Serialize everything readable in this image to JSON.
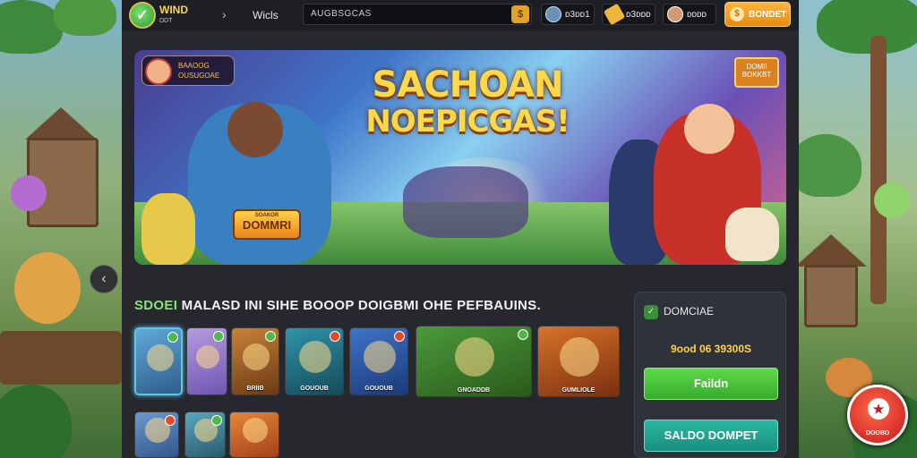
{
  "header": {
    "brand_name": "WIND",
    "brand_sub": "DDT",
    "nav_chevron": "›",
    "nav_link": "Wicls",
    "search_value": "AUGBSGCAS",
    "stats": [
      {
        "name": "stat-balance",
        "value": "ᴅ3ᴅᴅ1",
        "icon": "avatar-icon"
      },
      {
        "name": "stat-coins",
        "value": "ᴅ3ᴅᴅᴅ",
        "icon": "coin-icon"
      },
      {
        "name": "stat-profile",
        "value": "ᴅᴅᴅᴅ",
        "icon": "avatar-icon"
      }
    ],
    "deposit_label": "BONDET"
  },
  "banner": {
    "title_line1": "SACHOAN",
    "title_line2": "NOEPICGAS!",
    "player_line1": "BAAOOG",
    "player_line2": "OUSUGOAE",
    "promo_line1": "DOMII",
    "promo_line2": "BOKKBT",
    "game_logo_top": "SOAKOR",
    "game_logo_main": "DOMMRI"
  },
  "games_section": {
    "title_accent": "SDOEI",
    "title_rest": "MALASD INI SIHE BOOOP DOIGBMI OHE PEFBAUINS.",
    "tiles": [
      {
        "label": "",
        "color1": "#5ea9d8",
        "color2": "#2f5d8a",
        "badge": "green"
      },
      {
        "label": "",
        "color1": "#b59be0",
        "color2": "#6e56b0",
        "badge": "green"
      },
      {
        "label": "BRIIB",
        "color1": "#c98238",
        "color2": "#6a3a16",
        "badge": "green"
      },
      {
        "label": "GOUOUB",
        "color1": "#2f93a8",
        "color2": "#164b5a",
        "badge": "red"
      },
      {
        "label": "GOUOUB",
        "color1": "#3f74c8",
        "color2": "#1c3a78",
        "badge": "red"
      },
      {
        "label": "GNOADDB",
        "color1": "#4b9a3a",
        "color2": "#2a5a1c",
        "badge": "green"
      },
      {
        "label": "GUMLIOLE",
        "color1": "#d8732a",
        "color2": "#7a2f10",
        "badge": "none"
      },
      {
        "label": "",
        "color1": "#6a9ad0",
        "color2": "#34568a",
        "badge": "red"
      },
      {
        "label": "",
        "color1": "#5aa8c0",
        "color2": "#2a5a6a",
        "badge": "green"
      },
      {
        "label": "",
        "color1": "#e8863a",
        "color2": "#a2401a",
        "badge": "none"
      }
    ]
  },
  "wallet": {
    "title": "DOMCIAE",
    "amount": "9ood 06 39300S",
    "primary_button": "Faildn",
    "secondary_button": "SALDO DOMPET"
  },
  "fab": {
    "label": "DOOBO"
  },
  "colors": {
    "accent_green": "#5fd84a",
    "accent_orange": "#e78a14",
    "accent_teal": "#1a8f7e",
    "panel_bg": "#26282e",
    "title_gold": "#ffd84a"
  }
}
